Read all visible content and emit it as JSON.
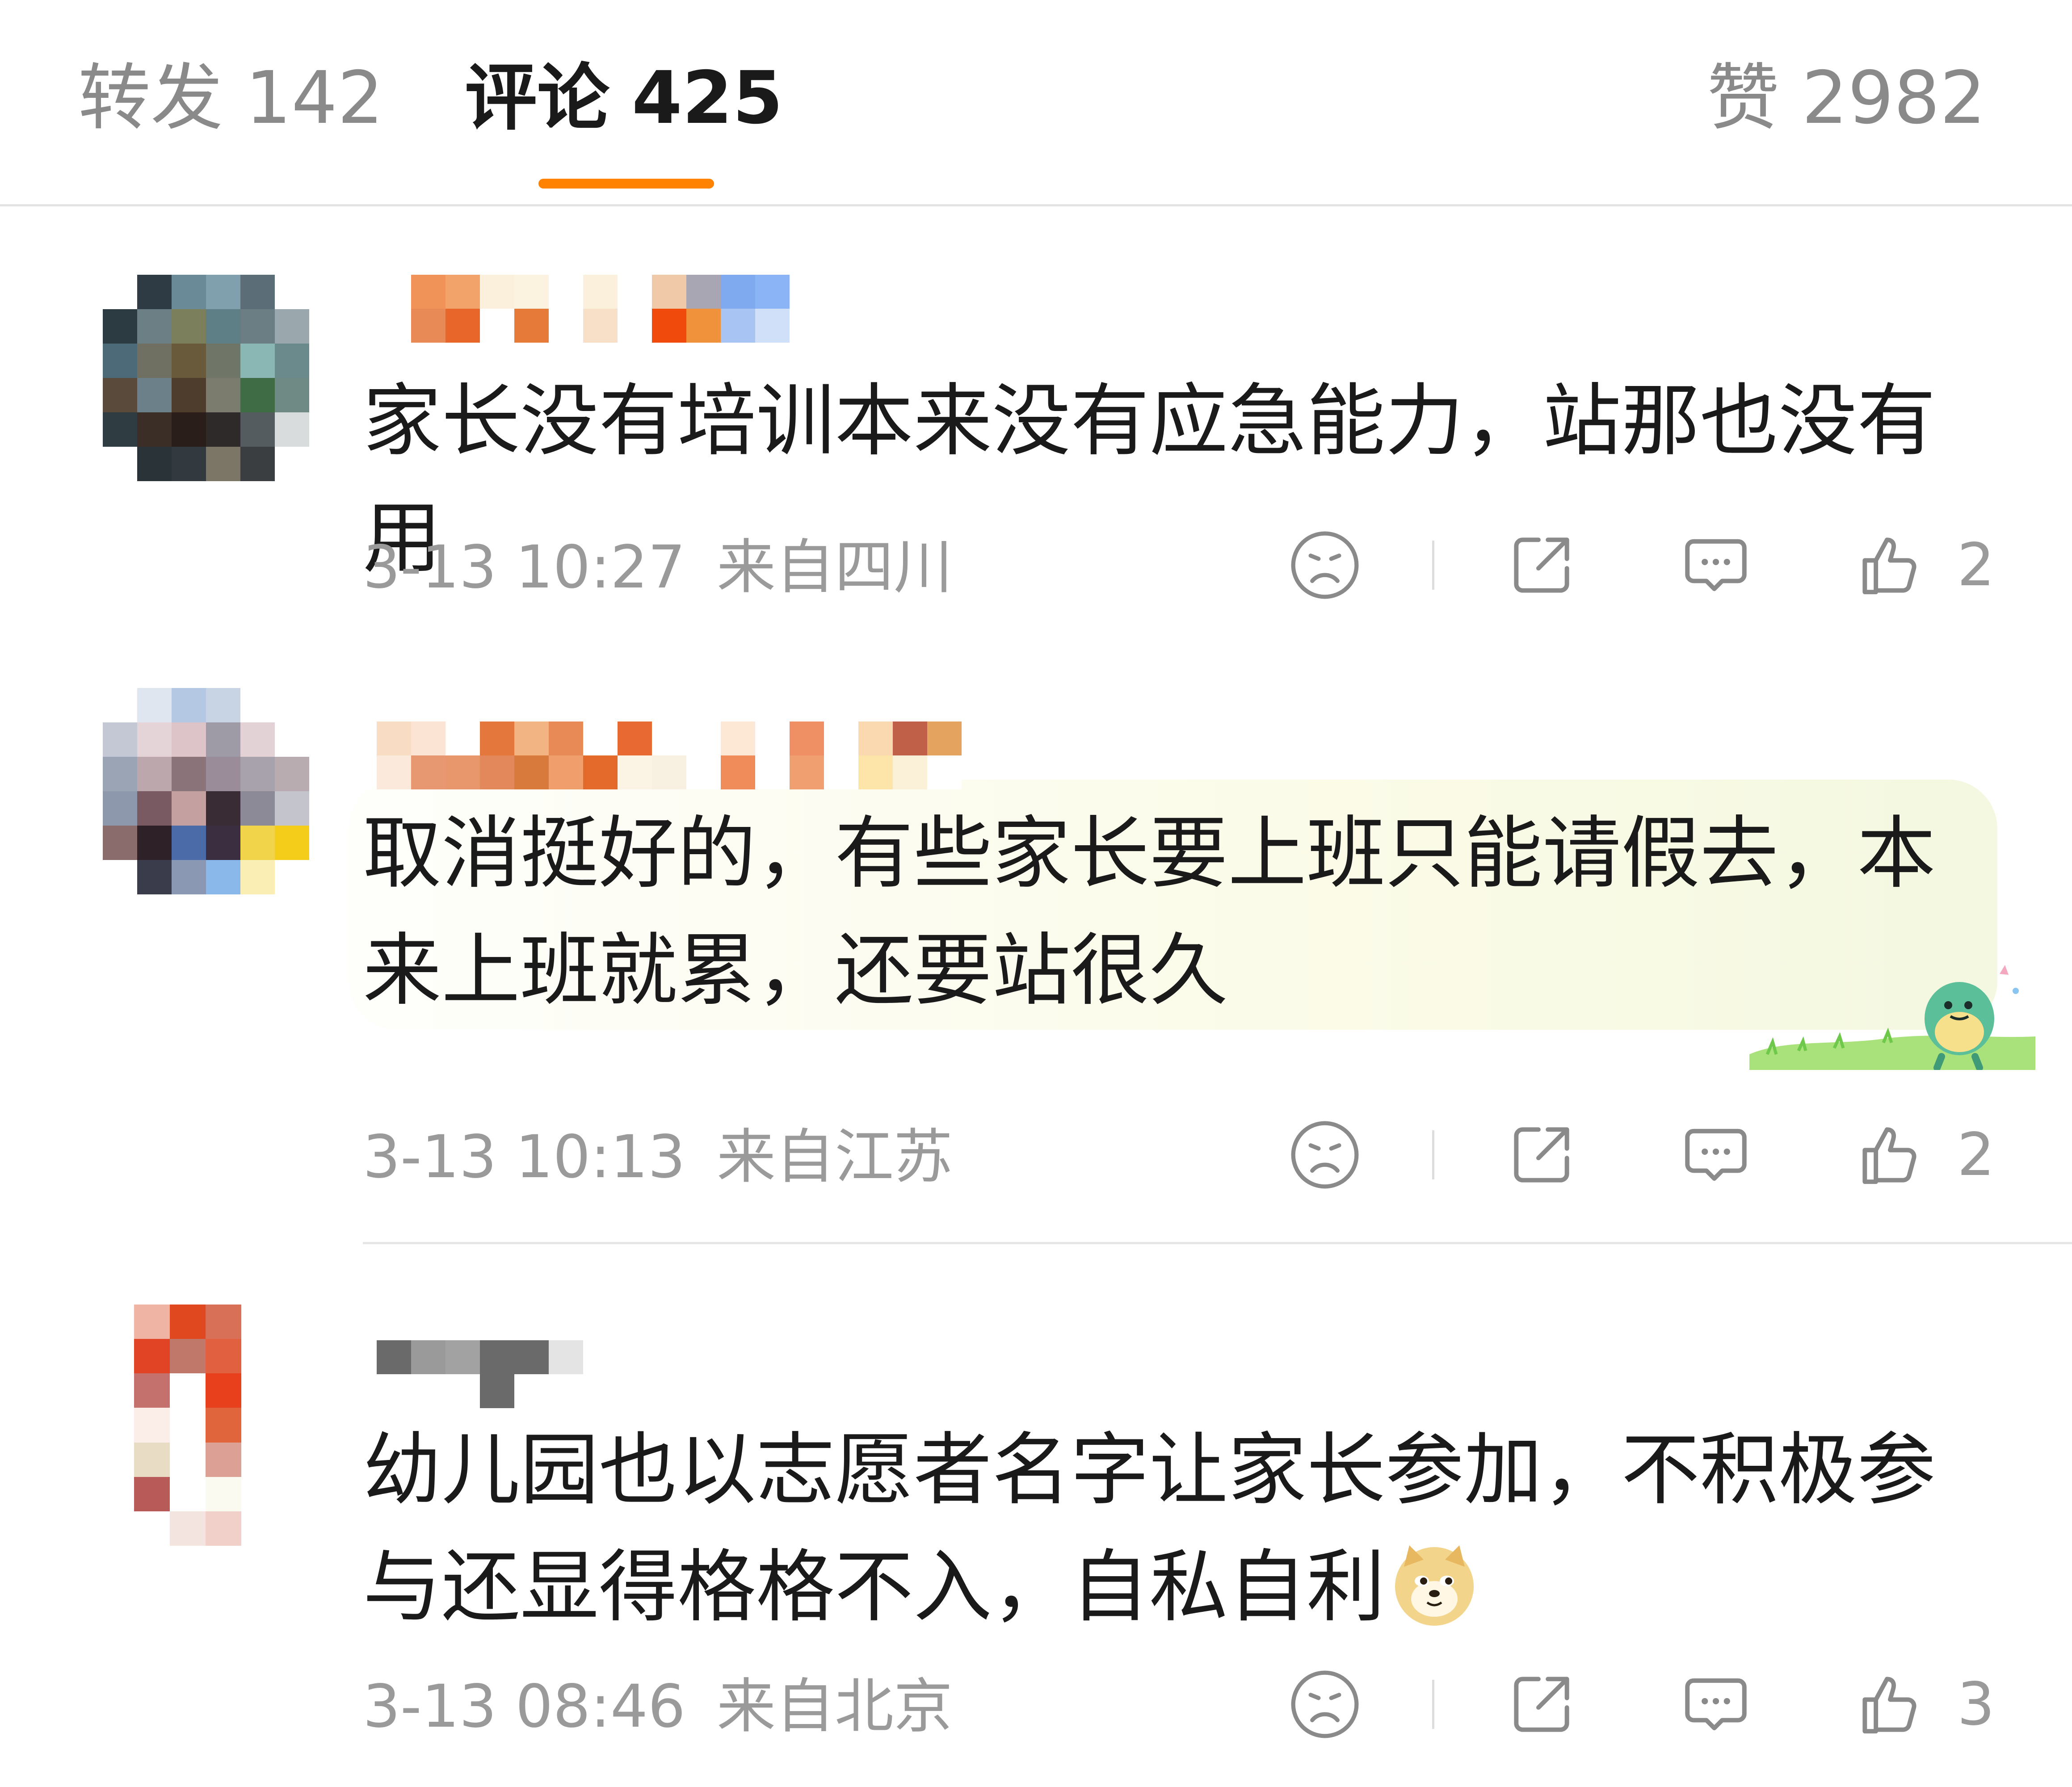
{
  "tabs": {
    "repost": {
      "label": "转发",
      "count": "142"
    },
    "comment": {
      "label": "评论",
      "count": "425"
    },
    "like": {
      "label": "赞",
      "count": "2982"
    }
  },
  "colors": {
    "accent": "#ff8200",
    "meta_text": "#9a9a9a",
    "body_text": "#1a1a1a",
    "tab_inactive": "#8a8a8a"
  },
  "comments": [
    {
      "text": "家长没有培训本来没有应急能力，站那也没有用",
      "time": "3-13 10:27",
      "location": "来自四川",
      "likes": "2"
    },
    {
      "text": "取消挺好的，有些家长要上班只能请假去，本来上班就累，还要站很久",
      "time": "3-13 10:13",
      "location": "来自江苏",
      "likes": "2"
    },
    {
      "text": "幼儿园也以志愿者名字让家长参加，不积极参与还显得格格不入，自私自利",
      "time": "3-13 08:46",
      "location": "来自北京",
      "likes": "3"
    }
  ],
  "icons": [
    "sad-face-icon",
    "share-icon",
    "comment-bubble-icon",
    "thumbs-up-icon",
    "doge-emoji-icon",
    "dinosaur-sticker-icon"
  ]
}
